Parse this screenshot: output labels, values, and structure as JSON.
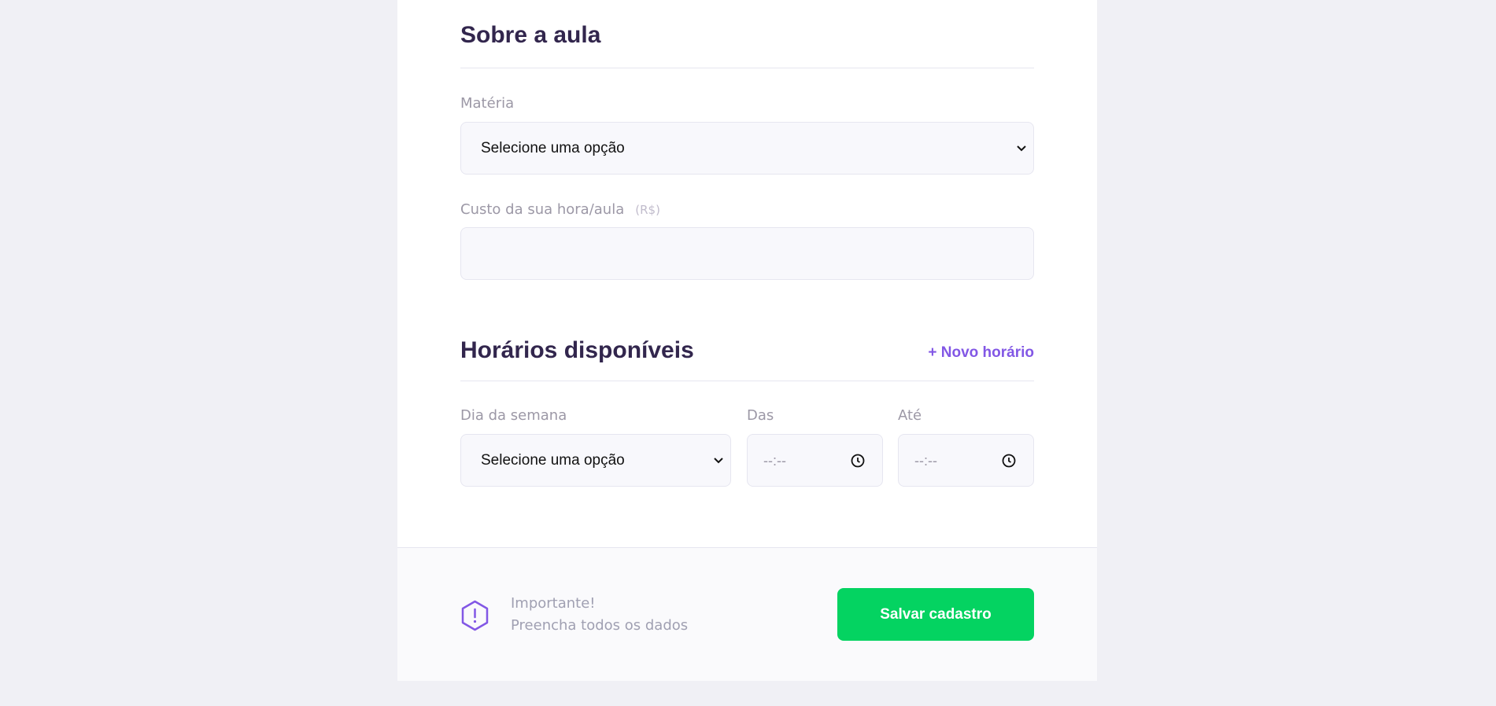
{
  "about_section": {
    "title": "Sobre a aula",
    "subject": {
      "label": "Matéria",
      "selected": "Selecione uma opção"
    },
    "cost": {
      "label": "Custo da sua hora/aula",
      "hint": "(R$)",
      "value": ""
    }
  },
  "schedule_section": {
    "title": "Horários disponíveis",
    "add_label": "+ Novo horário",
    "weekday": {
      "label": "Dia da semana",
      "selected": "Selecione uma opção"
    },
    "from": {
      "label": "Das",
      "value": "--:--"
    },
    "to": {
      "label": "Até",
      "value": "--:--"
    }
  },
  "footer": {
    "notice_title": "Importante!",
    "notice_text": "Preencha todos os dados",
    "save_label": "Salvar cadastro"
  },
  "colors": {
    "primary": "#8257E5",
    "title": "#32264D",
    "success": "#04D361",
    "background": "#F0F0F5"
  },
  "icons": {
    "warning": "warning-hexagon-icon",
    "clock": "clock-icon",
    "chevron": "chevron-down-icon"
  }
}
